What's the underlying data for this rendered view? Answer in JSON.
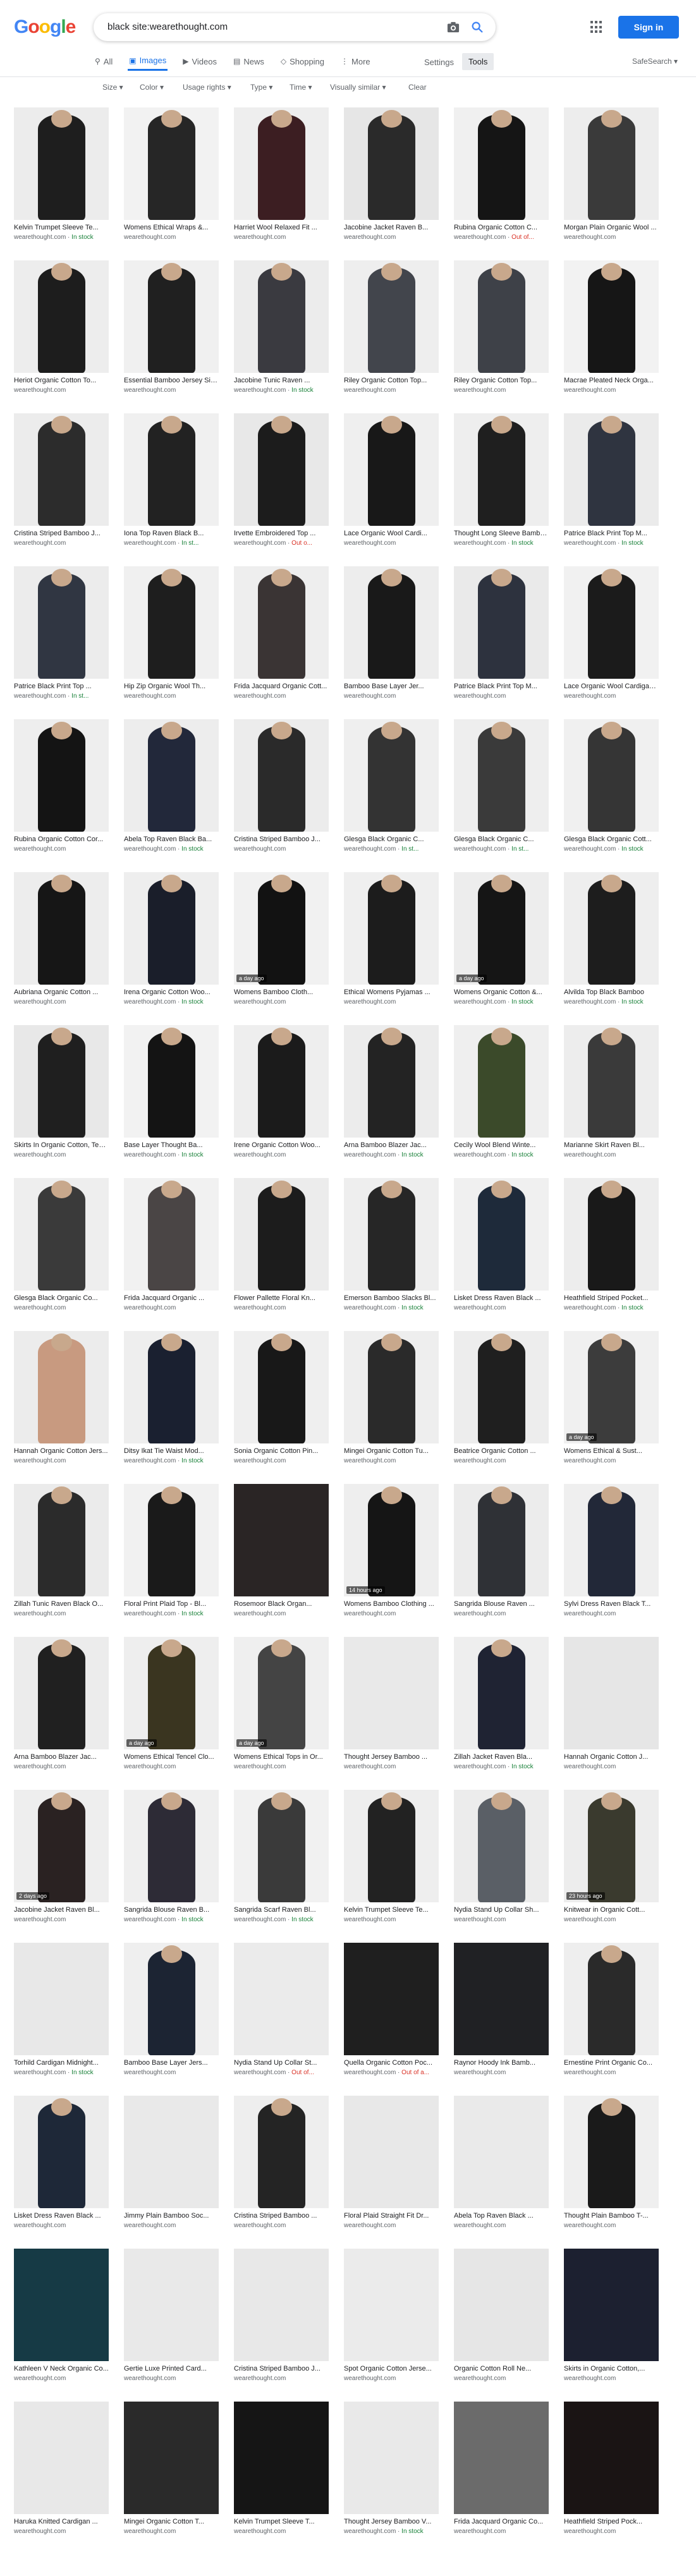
{
  "logo": [
    "G",
    "o",
    "o",
    "g",
    "l",
    "e"
  ],
  "logo_colors": [
    "#4285f4",
    "#ea4335",
    "#fbbc05",
    "#4285f4",
    "#34a853",
    "#ea4335"
  ],
  "search": {
    "query": "black site:wearethought.com"
  },
  "header": {
    "signin_label": "Sign in",
    "settings_label": "Settings",
    "tools_label": "Tools",
    "safesearch_label": "SafeSearch ▾"
  },
  "tabs": [
    {
      "label": "All",
      "icon": "search-icon",
      "glyph": "⚲"
    },
    {
      "label": "Images",
      "icon": "images-icon",
      "glyph": "▣",
      "active": true
    },
    {
      "label": "Videos",
      "icon": "videos-icon",
      "glyph": "▶"
    },
    {
      "label": "News",
      "icon": "news-icon",
      "glyph": "▤"
    },
    {
      "label": "Shopping",
      "icon": "shopping-icon",
      "glyph": "◇"
    },
    {
      "label": "More",
      "icon": "more-icon",
      "glyph": "⋮"
    }
  ],
  "filters": [
    "Size ▾",
    "Color ▾",
    "Usage rights ▾",
    "Type ▾",
    "Time ▾",
    "Visually similar ▾",
    "Clear"
  ],
  "source_domain": "wearethought.com",
  "rows": [
    [
      {
        "title": "Kelvin Trumpet Sleeve Te...",
        "stock": "In stock",
        "w": 150,
        "bg": "#ececec",
        "fig": "#1e1e1e"
      },
      {
        "title": "Womens Ethical Wraps &...",
        "stock": "",
        "w": 150,
        "bg": "#f2f2f2",
        "fig": "#262626"
      },
      {
        "title": "Harriet Wool Relaxed Fit ...",
        "stock": "",
        "w": 150,
        "bg": "#eeeeee",
        "fig": "#3c1e22"
      },
      {
        "title": "Jacobine Jacket Raven B...",
        "stock": "",
        "w": 150,
        "bg": "#e6e6e6",
        "fig": "#2a2a2a"
      },
      {
        "title": "Rubina Organic Cotton C...",
        "stock": "Out of...",
        "stockType": "out",
        "w": 150,
        "bg": "#f0f0f0",
        "fig": "#151515"
      },
      {
        "title": "Morgan Plain Organic Wool ...",
        "stock": "",
        "w": 150,
        "bg": "#ededed",
        "fig": "#3a3a3a"
      }
    ],
    [
      {
        "title": "Heriot Organic Cotton To...",
        "stock": "",
        "w": 150,
        "bg": "#ededed",
        "fig": "#1d1d1d"
      },
      {
        "title": "Essential Bamboo Jersey Sin...",
        "stock": "",
        "w": 150,
        "bg": "#f0f0f0",
        "fig": "#202020"
      },
      {
        "title": "Jacobine Tunic Raven ...",
        "stock": "In stock",
        "w": 150,
        "bg": "#ececec",
        "fig": "#3a3a40"
      },
      {
        "title": "Riley Organic Cotton Top...",
        "stock": "",
        "w": 150,
        "bg": "#eeeeee",
        "fig": "#42454c"
      },
      {
        "title": "Riley Organic Cotton Top...",
        "stock": "",
        "w": 150,
        "bg": "#efefef",
        "fig": "#3e4148"
      },
      {
        "title": "Macrae Pleated Neck Orga...",
        "stock": "",
        "w": 150,
        "bg": "#f2f2f2",
        "fig": "#161616"
      }
    ],
    [
      {
        "title": "Cristina Striped Bamboo J...",
        "stock": "",
        "w": 150,
        "bg": "#ececec",
        "fig": "#2c2c2c"
      },
      {
        "title": "Iona Top Raven Black B...",
        "stock": "In st...",
        "w": 150,
        "bg": "#f0f0f0",
        "fig": "#222222"
      },
      {
        "title": "Irvette Embroidered Top ...",
        "stock": "Out o...",
        "stockType": "out",
        "w": 150,
        "bg": "#e8e8e8",
        "fig": "#1c1c1c"
      },
      {
        "title": "Lace Organic Wool Cardi...",
        "stock": "",
        "w": 150,
        "bg": "#efefef",
        "fig": "#181818"
      },
      {
        "title": "Thought Long Sleeve Bambo...",
        "stock": "In stock",
        "w": 150,
        "bg": "#eeeeee",
        "fig": "#1f1f1f"
      },
      {
        "title": "Patrice Black Print Top M...",
        "stock": "In stock",
        "w": 150,
        "bg": "#ebebeb",
        "fig": "#2f3440"
      }
    ],
    [
      {
        "title": "Patrice Black Print Top ...",
        "stock": "In st...",
        "w": 150,
        "bg": "#ececec",
        "fig": "#303642"
      },
      {
        "title": "Hip Zip Organic Wool Th...",
        "stock": "",
        "w": 150,
        "bg": "#f0f0f0",
        "fig": "#1e1e1e"
      },
      {
        "title": "Frida Jacquard Organic Cott...",
        "stock": "",
        "w": 150,
        "bg": "#eeeeee",
        "fig": "#3a3434"
      },
      {
        "title": "Bamboo Base Layer Jer...",
        "stock": "",
        "w": 150,
        "bg": "#ededed",
        "fig": "#191919"
      },
      {
        "title": "Patrice Black Print Top M...",
        "stock": "",
        "w": 150,
        "bg": "#eaeaea",
        "fig": "#2d323e"
      },
      {
        "title": "Lace Organic Wool Cardigan ...",
        "stock": "",
        "w": 150,
        "bg": "#f1f1f1",
        "fig": "#1b1b1b"
      }
    ],
    [
      {
        "title": "Rubina Organic Cotton Cor...",
        "stock": "",
        "w": 150,
        "bg": "#eeeeee",
        "fig": "#141414"
      },
      {
        "title": "Abela Top Raven Black Ba...",
        "stock": "In stock",
        "w": 150,
        "bg": "#ededed",
        "fig": "#22283a"
      },
      {
        "title": "Cristina Striped Bamboo J...",
        "stock": "",
        "w": 150,
        "bg": "#ececec",
        "fig": "#2a2a2a"
      },
      {
        "title": "Glesga Black Organic C...",
        "stock": "In st...",
        "w": 150,
        "bg": "#efefef",
        "fig": "#333333"
      },
      {
        "title": "Glesga Black Organic C...",
        "stock": "In st...",
        "w": 150,
        "bg": "#eeeeee",
        "fig": "#3a3a3a"
      },
      {
        "title": "Glesga Black Organic Cott...",
        "stock": "In stock",
        "w": 150,
        "bg": "#f0f0f0",
        "fig": "#353535"
      }
    ],
    [
      {
        "title": "Aubriana Organic Cotton ...",
        "stock": "",
        "w": 150,
        "bg": "#ededed",
        "fig": "#161616"
      },
      {
        "title": "Irena Organic Cotton Woo...",
        "stock": "In stock",
        "w": 150,
        "bg": "#eeeeee",
        "fig": "#1a1e2a"
      },
      {
        "title": "Womens Bamboo Cloth...",
        "stock": "",
        "w": 150,
        "bg": "#f1f1f1",
        "fig": "#121212",
        "ago": "a day ago"
      },
      {
        "title": "Ethical Womens Pyjamas ...",
        "stock": "",
        "w": 150,
        "bg": "#efefef",
        "fig": "#1c1c1c"
      },
      {
        "title": "Womens Organic Cotton &...",
        "stock": "In stock",
        "w": 150,
        "bg": "#ededed",
        "fig": "#151515",
        "ago": "a day ago"
      },
      {
        "title": "Alvilda Top Black Bamboo",
        "stock": "In stock",
        "w": 150,
        "bg": "#eeeeee",
        "fig": "#1d1d1d"
      }
    ],
    [
      {
        "title": "Skirts In Organic Cotton, Tenc...",
        "stock": "",
        "w": 150,
        "bg": "#e8e8e8",
        "fig": "#1f1f1f"
      },
      {
        "title": "Base Layer Thought Ba...",
        "stock": "In stock",
        "w": 150,
        "bg": "#f2f2f2",
        "fig": "#141414"
      },
      {
        "title": "Irene Organic Cotton Woo...",
        "stock": "",
        "w": 150,
        "bg": "#eeeeee",
        "fig": "#1b1b1b"
      },
      {
        "title": "Arna Bamboo Blazer Jac...",
        "stock": "In stock",
        "w": 150,
        "bg": "#ececec",
        "fig": "#232323"
      },
      {
        "title": "Cecily Wool Blend Winte...",
        "stock": "In stock",
        "w": 150,
        "bg": "#efefef",
        "fig": "#3b4a2a"
      },
      {
        "title": "Marianne Skirt Raven Bl...",
        "stock": "",
        "w": 150,
        "bg": "#ededed",
        "fig": "#3a3a3a"
      }
    ],
    [
      {
        "title": "Glesga Black Organic Co...",
        "stock": "",
        "w": 150,
        "bg": "#eeeeee",
        "fig": "#3a3a3a"
      },
      {
        "title": "Frida Jacquard Organic ...",
        "stock": "",
        "w": 150,
        "bg": "#f1f1f1",
        "fig": "#4a4545"
      },
      {
        "title": "Flower Pallette Floral Kn...",
        "stock": "",
        "w": 150,
        "bg": "#ececec",
        "fig": "#1c1c1c"
      },
      {
        "title": "Emerson Bamboo Slacks Bl...",
        "stock": "In stock",
        "w": 150,
        "bg": "#eeeeee",
        "fig": "#262626"
      },
      {
        "title": "Lisket Dress Raven Black ...",
        "stock": "",
        "w": 150,
        "bg": "#f0f0f0",
        "fig": "#1e2a3a"
      },
      {
        "title": "Heathfield Striped Pocket...",
        "stock": "In stock",
        "w": 150,
        "bg": "#ededed",
        "fig": "#191919"
      }
    ],
    [
      {
        "title": "Hannah Organic Cotton Jers...",
        "stock": "",
        "w": 150,
        "bg": "#ececec",
        "fig": "#c89a80"
      },
      {
        "title": "Ditsy Ikat Tie Waist Mod...",
        "stock": "In stock",
        "w": 150,
        "bg": "#eeeeee",
        "fig": "#1a2030"
      },
      {
        "title": "Sonia Organic Cotton Pin...",
        "stock": "",
        "w": 150,
        "bg": "#efefef",
        "fig": "#181818"
      },
      {
        "title": "Mingei Organic Cotton Tu...",
        "stock": "",
        "w": 150,
        "bg": "#eeeeee",
        "fig": "#2a2a2a"
      },
      {
        "title": "Beatrice Organic Cotton ...",
        "stock": "",
        "w": 150,
        "bg": "#ededed",
        "fig": "#1f1f1f"
      },
      {
        "title": "Womens Ethical & Sust...",
        "stock": "",
        "w": 150,
        "bg": "#f0f0f0",
        "fig": "#3c3c3c",
        "ago": "a day ago"
      }
    ],
    [
      {
        "title": "Zillah Tunic Raven Black O...",
        "stock": "",
        "w": 150,
        "bg": "#ebebeb",
        "fig": "#2b2b2b"
      },
      {
        "title": "Floral Print Plaid Top - Bl...",
        "stock": "In stock",
        "w": 150,
        "bg": "#f1f1f1",
        "fig": "#1a1a1a"
      },
      {
        "title": "Rosemoor Black Organ...",
        "stock": "",
        "w": 150,
        "bg": "#2a2525",
        "fig": "#2a2525"
      },
      {
        "title": "Womens Bamboo Clothing ...",
        "stock": "",
        "w": 150,
        "bg": "#eeeeee",
        "fig": "#151515",
        "ago": "14 hours ago"
      },
      {
        "title": "Sangrida Blouse Raven ...",
        "stock": "",
        "w": 150,
        "bg": "#ececec",
        "fig": "#2f3136"
      },
      {
        "title": "Sylvi Dress Raven Black T...",
        "stock": "",
        "w": 150,
        "bg": "#efefef",
        "fig": "#222838"
      }
    ],
    [
      {
        "title": "Arna Bamboo Blazer Jac...",
        "stock": "",
        "w": 150,
        "bg": "#ececec",
        "fig": "#202020"
      },
      {
        "title": "Womens Ethical Tencel Clo...",
        "stock": "",
        "w": 150,
        "bg": "#eeeeee",
        "fig": "#3a3520",
        "ago": "a day ago"
      },
      {
        "title": "Womens Ethical Tops in Or...",
        "stock": "",
        "w": 150,
        "bg": "#efefef",
        "fig": "#444444",
        "ago": "a day ago"
      },
      {
        "title": "Thought Jersey Bamboo ...",
        "stock": "",
        "w": 150,
        "bg": "#e9e9e9",
        "fig": "#e9e9e9"
      },
      {
        "title": "Zillah Jacket Raven Bla...",
        "stock": "In stock",
        "w": 150,
        "bg": "#eeeeee",
        "fig": "#1f2333"
      },
      {
        "title": "Hannah Organic Cotton J...",
        "stock": "",
        "w": 150,
        "bg": "#e6e6e6",
        "fig": "#e6e6e6"
      }
    ],
    [
      {
        "title": "Jacobine Jacket Raven Bl...",
        "stock": "",
        "w": 150,
        "bg": "#eeeeee",
        "fig": "#2a2222",
        "ago": "2 days ago"
      },
      {
        "title": "Sangrida Blouse Raven B...",
        "stock": "In stock",
        "w": 150,
        "bg": "#efefef",
        "fig": "#2d2b36"
      },
      {
        "title": "Sangrida Scarf Raven Bl...",
        "stock": "In stock",
        "w": 150,
        "bg": "#f1f1f1",
        "fig": "#3a3a3a"
      },
      {
        "title": "Kelvin Trumpet Sleeve Te...",
        "stock": "",
        "w": 150,
        "bg": "#eeeeee",
        "fig": "#222222"
      },
      {
        "title": "Nydia Stand Up Collar Sh...",
        "stock": "",
        "w": 150,
        "bg": "#ececec",
        "fig": "#5a5f66"
      },
      {
        "title": "Knitwear in Organic Cott...",
        "stock": "",
        "w": 150,
        "bg": "#ededed",
        "fig": "#3a3a2e",
        "ago": "23 hours ago"
      }
    ],
    [
      {
        "title": "Torhild Cardigan Midnight...",
        "stock": "In stock",
        "w": 150,
        "bg": "#e8e8e8",
        "fig": "#e8e8e8"
      },
      {
        "title": "Bamboo Base Layer Jers...",
        "stock": "",
        "w": 150,
        "bg": "#efefef",
        "fig": "#1c2433"
      },
      {
        "title": "Nydia Stand Up Collar St...",
        "stock": "Out of...",
        "stockType": "out",
        "w": 150,
        "bg": "#ebebeb",
        "fig": "#ebebeb"
      },
      {
        "title": "Quella Organic Cotton Poc...",
        "stock": "Out of a...",
        "stockType": "out",
        "w": 150,
        "bg": "#1f1f1f",
        "fig": "#1f1f1f"
      },
      {
        "title": "Raynor Hoody Ink Bamb...",
        "stock": "",
        "w": 150,
        "bg": "#202124",
        "fig": "#202124"
      },
      {
        "title": "Ernestine Print Organic Co...",
        "stock": "",
        "w": 150,
        "bg": "#eeeeee",
        "fig": "#2a2a2a"
      }
    ],
    [
      {
        "title": "Lisket Dress Raven Black ...",
        "stock": "",
        "w": 150,
        "bg": "#ececec",
        "fig": "#1e2838"
      },
      {
        "title": "Jimmy Plain Bamboo Soc...",
        "stock": "",
        "w": 150,
        "bg": "#e9e9e9",
        "fig": "#e9e9e9"
      },
      {
        "title": "Cristina Striped Bamboo ...",
        "stock": "",
        "w": 150,
        "bg": "#eeeeee",
        "fig": "#242424"
      },
      {
        "title": "Floral Plaid Straight Fit Dr...",
        "stock": "",
        "w": 150,
        "bg": "#e8e8e8",
        "fig": "#e8e8e8"
      },
      {
        "title": "Abela Top Raven Black ...",
        "stock": "",
        "w": 150,
        "bg": "#eaeaea",
        "fig": "#eaeaea"
      },
      {
        "title": "Thought Plain Bamboo T-...",
        "stock": "",
        "w": 150,
        "bg": "#efefef",
        "fig": "#1a1a1a"
      }
    ],
    [
      {
        "title": "Kathleen V Neck Organic Co...",
        "stock": "",
        "w": 150,
        "bg": "#163a45",
        "fig": "#163a45"
      },
      {
        "title": "Gertie Luxe Printed Card...",
        "stock": "",
        "w": 150,
        "bg": "#e9e9e9",
        "fig": "#e9e9e9"
      },
      {
        "title": "Cristina Striped Bamboo J...",
        "stock": "",
        "w": 150,
        "bg": "#e8e8e8",
        "fig": "#e8e8e8"
      },
      {
        "title": "Spot Organic Cotton Jerse...",
        "stock": "",
        "w": 150,
        "bg": "#ebebeb",
        "fig": "#ebebeb"
      },
      {
        "title": "Organic Cotton Roll Ne...",
        "stock": "",
        "w": 150,
        "bg": "#e6e6e6",
        "fig": "#e6e6e6"
      },
      {
        "title": "Skirts in Organic Cotton,...",
        "stock": "",
        "w": 150,
        "bg": "#1c2030",
        "fig": "#1c2030"
      }
    ],
    [
      {
        "title": "Haruka Knitted Cardigan ...",
        "stock": "",
        "w": 150,
        "bg": "#e8e8e8",
        "fig": "#e8e8e8"
      },
      {
        "title": "Mingei Organic Cotton T...",
        "stock": "",
        "w": 150,
        "bg": "#2a2a2a",
        "fig": "#2a2a2a"
      },
      {
        "title": "Kelvin Trumpet Sleeve T...",
        "stock": "",
        "w": 150,
        "bg": "#151515",
        "fig": "#151515"
      },
      {
        "title": "Thought Jersey Bamboo V...",
        "stock": "In stock",
        "w": 150,
        "bg": "#e9e9e9",
        "fig": "#e9e9e9"
      },
      {
        "title": "Frida Jacquard Organic Co...",
        "stock": "",
        "w": 150,
        "bg": "#6b6b6b",
        "fig": "#6b6b6b"
      },
      {
        "title": "Heathfield Striped Pock...",
        "stock": "",
        "w": 150,
        "bg": "#1a1414",
        "fig": "#1a1414"
      }
    ]
  ]
}
